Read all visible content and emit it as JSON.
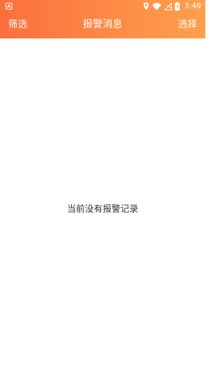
{
  "status_bar": {
    "time": "3:49",
    "icons": [
      "app-notification-icon",
      "location-icon",
      "wifi-icon",
      "signal-off-icon",
      "battery-charging-icon"
    ]
  },
  "nav": {
    "left_label": "筛选",
    "title": "报警消息",
    "right_label": "选择"
  },
  "content": {
    "empty_text": "当前没有报警记录"
  },
  "colors": {
    "header_gradient_start": "#fb6f3e",
    "header_gradient_end": "#ffa04c",
    "background": "#ffffff",
    "empty_text": "#333333"
  }
}
